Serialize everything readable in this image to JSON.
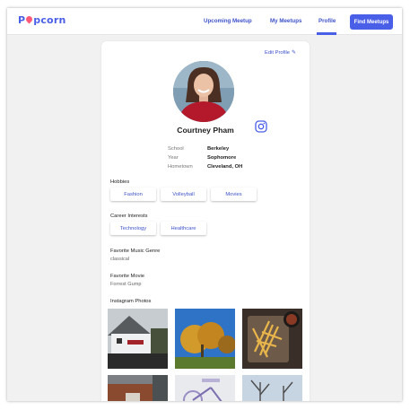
{
  "nav": {
    "logo": "Popcorn",
    "links": [
      "Upcoming Meetup",
      "My Meetups",
      "Profile"
    ],
    "active_link": "Profile",
    "find_button": "Find Meetups"
  },
  "profile": {
    "edit_label": "Edit Profile",
    "name": "Courtney Pham",
    "info": [
      {
        "label": "School",
        "value": "Berkeley"
      },
      {
        "label": "Year",
        "value": "Sophomore"
      },
      {
        "label": "Hometown",
        "value": "Cleveland, OH"
      }
    ],
    "hobbies_title": "Hobbies",
    "hobbies": [
      "Fashion",
      "Volleyball",
      "Movies"
    ],
    "career_title": "Career Interests",
    "careers": [
      "Technology",
      "Healthcare"
    ],
    "music_title": "Favorite Music Genre",
    "music_value": "classical",
    "movie_title": "Favorite Movie",
    "movie_value": "Forrest Gump",
    "photos_title": "Instagram Photos"
  },
  "colors": {
    "accent": "#4a5fe8",
    "logo_pin": "#ff5a78",
    "link": "#3d52c9"
  },
  "icons": {
    "edit": "pencil-icon",
    "social": "instagram-icon"
  }
}
